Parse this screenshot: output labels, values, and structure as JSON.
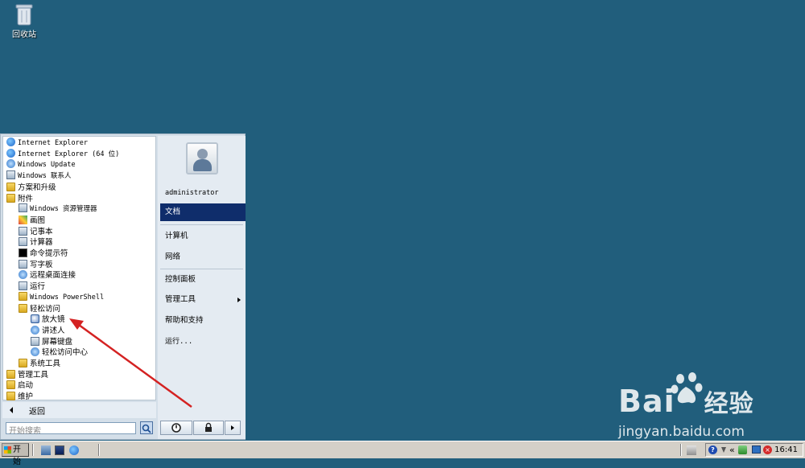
{
  "desktop": {
    "recycle_bin_label": "回收站"
  },
  "start_menu": {
    "programs": [
      {
        "label": "Internet Explorer",
        "icon": "ie-icon",
        "indent": 0,
        "mono": true
      },
      {
        "label": "Internet Explorer (64 位)",
        "icon": "ie-icon",
        "indent": 0,
        "mono": true
      },
      {
        "label": "Windows Update",
        "icon": "windows-update-icon",
        "indent": 0,
        "mono": true
      },
      {
        "label": "Windows 联系人",
        "icon": "contacts-icon",
        "indent": 0,
        "mono": true
      },
      {
        "label": "方案和升级",
        "icon": "folder-icon",
        "indent": 0
      },
      {
        "label": "附件",
        "icon": "folder-icon",
        "indent": 0
      },
      {
        "label": "Windows 资源管理器",
        "icon": "explorer-icon",
        "indent": 1,
        "mono": true
      },
      {
        "label": "画图",
        "icon": "paint-icon",
        "indent": 1
      },
      {
        "label": "记事本",
        "icon": "notepad-icon",
        "indent": 1
      },
      {
        "label": "计算器",
        "icon": "calculator-icon",
        "indent": 1
      },
      {
        "label": "命令提示符",
        "icon": "cmd-icon",
        "indent": 1
      },
      {
        "label": "写字板",
        "icon": "wordpad-icon",
        "indent": 1
      },
      {
        "label": "远程桌面连接",
        "icon": "remote-desktop-icon",
        "indent": 1
      },
      {
        "label": "运行",
        "icon": "run-icon",
        "indent": 1
      },
      {
        "label": "Windows PowerShell",
        "icon": "folder-icon",
        "indent": 1,
        "mono": true
      },
      {
        "label": "轻松访问",
        "icon": "folder-icon",
        "indent": 1
      },
      {
        "label": "放大镜",
        "icon": "magnifier-icon",
        "indent": 2
      },
      {
        "label": "讲述人",
        "icon": "narrator-icon",
        "indent": 2
      },
      {
        "label": "屏幕键盘",
        "icon": "keyboard-icon",
        "indent": 2
      },
      {
        "label": "轻松访问中心",
        "icon": "ease-of-access-icon",
        "indent": 2
      },
      {
        "label": "系统工具",
        "icon": "folder-icon",
        "indent": 1
      },
      {
        "label": "管理工具",
        "icon": "folder-icon",
        "indent": 0
      },
      {
        "label": "启动",
        "icon": "folder-icon",
        "indent": 0
      },
      {
        "label": "维护",
        "icon": "folder-icon",
        "indent": 0
      }
    ],
    "back_label": "返回",
    "search_placeholder": "开始搜索",
    "user_name": "administrator",
    "right_items": {
      "documents": "文档",
      "computer": "计算机",
      "network": "网络",
      "control_panel": "控制面板",
      "admin_tools": "管理工具",
      "help": "帮助和支持",
      "run": "运行..."
    }
  },
  "taskbar": {
    "start_label": "开始",
    "clock": "16:41",
    "chevron": "«"
  },
  "watermark": {
    "brand": "Bai",
    "brand_cn": "经验",
    "url": "jingyan.baidu.com"
  },
  "colors": {
    "desktop": "#215e7c",
    "selected": "#0f2d6b",
    "arrow": "#d42222"
  }
}
